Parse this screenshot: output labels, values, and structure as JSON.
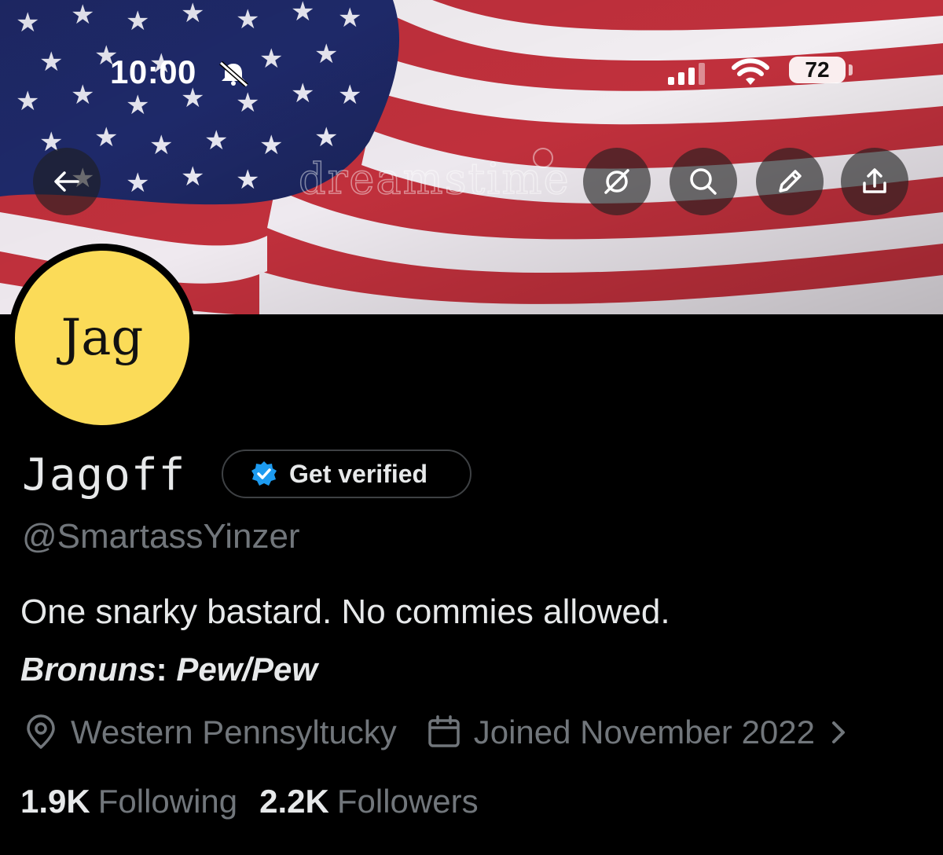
{
  "status_bar": {
    "time": "10:00",
    "battery": "72"
  },
  "profile": {
    "avatar_text": "Jag",
    "display_name": "Jagoff",
    "get_verified_label": "Get verified",
    "handle": "@SmartassYinzer",
    "bio": "One snarky bastard. No commies allowed.",
    "pronouns_label": "Bronuns",
    "pronouns_sep": ": ",
    "pronouns_value": "Pew/Pew",
    "location": "Western Pennsyltucky",
    "joined": "Joined November 2022",
    "following_count": "1.9K",
    "following_label": "Following",
    "followers_count": "2.2K",
    "followers_label": "Followers"
  },
  "banner": {
    "watermark": "dreamstime"
  },
  "icons": {
    "back": "arrow-left-icon",
    "grok": "slashed-circle-icon",
    "search": "search-icon",
    "edit": "pencil-icon",
    "share": "share-icon",
    "verified": "verified-badge-icon",
    "location": "location-pin-icon",
    "calendar": "calendar-icon",
    "chevron": "chevron-right-icon",
    "mute": "bell-slash-icon",
    "signal": "cellular-signal-icon",
    "wifi": "wifi-icon"
  },
  "colors": {
    "background": "#000000",
    "avatar": "#fbdb58",
    "verified_blue": "#1d9bf0",
    "muted_text": "#71767b",
    "primary_text": "#e7e9ea"
  }
}
